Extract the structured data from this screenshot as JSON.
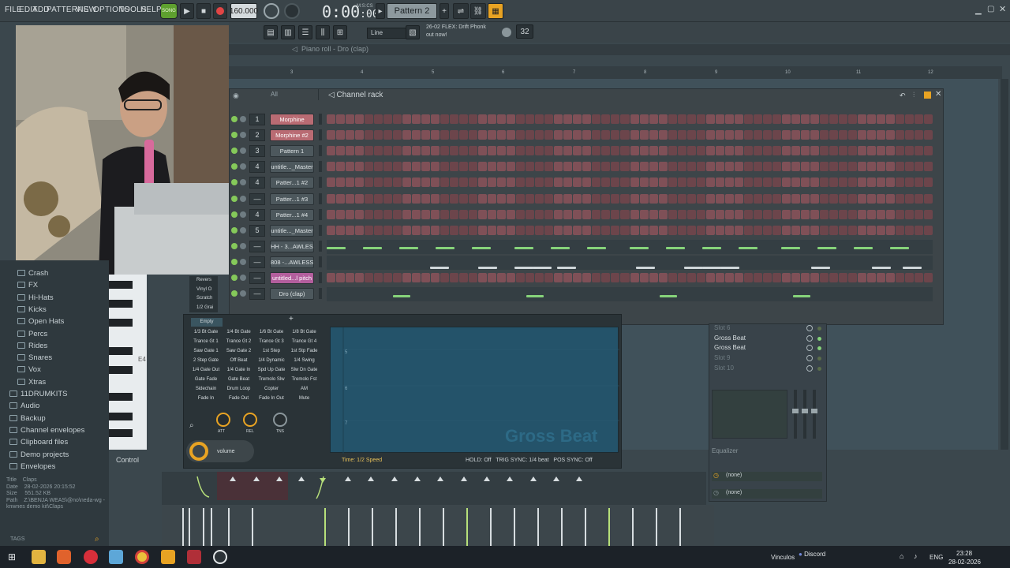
{
  "menu": [
    "FILE",
    "EDIT",
    "ADD",
    "PATTERNS",
    "VIEW",
    "OPTIONS",
    "TOOLS",
    "HELP"
  ],
  "transport": {
    "song_label": "SONG",
    "tempo": "160.000",
    "time": "0:00",
    "time_sub": ":00",
    "time_unit": "M:S:CS",
    "pattern": "Pattern 2"
  },
  "hint": {
    "line1": "26-02  FLEX: Drift Phonk",
    "line2": "out now!"
  },
  "snap": "Line",
  "piano_roll": {
    "title": "Piano roll - Dro (clap)",
    "ruler": [
      "3",
      "4",
      "5",
      "6",
      "7",
      "8",
      "9",
      "10",
      "11",
      "12"
    ]
  },
  "channel_rack": {
    "title": "Channel rack",
    "filter": "All",
    "channels": [
      {
        "num": "1",
        "name": "Morphine",
        "style": "red"
      },
      {
        "num": "2",
        "name": "Morphine #2",
        "style": "red"
      },
      {
        "num": "3",
        "name": "Pattern 1",
        "style": ""
      },
      {
        "num": "4",
        "name": "untitle..._Master",
        "style": ""
      },
      {
        "num": "4",
        "name": "Patter...1 #2",
        "style": ""
      },
      {
        "num": "—",
        "name": "Patter...1 #3",
        "style": ""
      },
      {
        "num": "4",
        "name": "Patter...1 #4",
        "style": ""
      },
      {
        "num": "5",
        "name": "untitle..._Master",
        "style": ""
      },
      {
        "num": "—",
        "name": "HH - 3...AWLESS",
        "style": ""
      },
      {
        "num": "—",
        "name": "808 -...AWLESS",
        "style": ""
      },
      {
        "num": "—",
        "name": "untitled...l pitch",
        "style": "pink"
      },
      {
        "num": "—",
        "name": "Dro (clap)",
        "style": ""
      }
    ]
  },
  "browser": {
    "items": [
      "Crash",
      "FX",
      "Hi-Hats",
      "Kicks",
      "Open Hats",
      "Percs",
      "Rides",
      "Snares",
      "Vox",
      "Xtras",
      "11DRUMKITS",
      "Audio",
      "Backup",
      "Channel envelopes",
      "Clipboard files",
      "Demo projects",
      "Envelopes"
    ],
    "info": {
      "title_label": "Title",
      "title_value": "Claps",
      "date_label": "Date",
      "date_value": "28-02-2026 20:15:52",
      "size_label": "Size",
      "size_value": "551.52 KB",
      "path_label": "Path",
      "path_value": "Z:\\BENJA WEAS\\@no\\neda-wg - knwnes demo kit\\Claps"
    },
    "tags": "TAGS"
  },
  "gross_beat": {
    "presets_header": [
      "Revers",
      "Vinyl O",
      "Scratch",
      "1/2 Grai"
    ],
    "empty": "Empty",
    "presets": [
      [
        "1/3 Bt Gate",
        "1/4 Bt Gate",
        "1/6 Bt Gate",
        "1/8 Bt Gate"
      ],
      [
        "Trance Gt 1",
        "Trance Gt 2",
        "Trance Gt 3",
        "Trance Gt 4"
      ],
      [
        "Saw Gate 1",
        "Saw Gate 2",
        "1st Step",
        "1st Stp Fade"
      ],
      [
        "2 Step Gate",
        "Off Beat",
        "1/4 Dynamic",
        "1/4 Swing"
      ],
      [
        "1/4 Gate Out",
        "1/4 Gate In",
        "Spd Up Gate",
        "Slw Dn Gate"
      ],
      [
        "Gate Fade",
        "Gate Beat",
        "Tremolo Slw",
        "Tremolo Fst"
      ],
      [
        "Sidechain",
        "Drum Loop",
        "Copter",
        "AM"
      ],
      [
        "Fade In",
        "Fade Out",
        "Fade In Out",
        "Mute"
      ]
    ],
    "knobs": [
      "ATT",
      "REL",
      "TNS"
    ],
    "volume": "volume",
    "logo": "Gross Beat",
    "time": "Time: 1/2 Speed",
    "hold": "HOLD:  Off",
    "trig": "TRIG SYNC: 1/4 beat",
    "pos": "POS SYNC:  Off"
  },
  "mixer": {
    "slots": [
      {
        "label": "Slot 6",
        "dim": true
      },
      {
        "label": "Gross Beat",
        "dim": false
      },
      {
        "label": "Gross Beat",
        "dim": false
      },
      {
        "label": "Slot 9",
        "dim": true
      },
      {
        "label": "Slot 10",
        "dim": true
      }
    ],
    "equalizer": "Equalizer",
    "none1": "(none)",
    "none2": "(none)"
  },
  "bottom": {
    "control": "Control",
    "note_e4": "E4"
  },
  "taskbar": {
    "vinculos": "Vinculos",
    "discord": "Discord",
    "lang": "ENG",
    "time": "23:28",
    "date": "28-02-2026"
  },
  "colors": {
    "accent_green": "#86d37a",
    "step_red": "#7f5057",
    "rec_red": "#e14545"
  }
}
